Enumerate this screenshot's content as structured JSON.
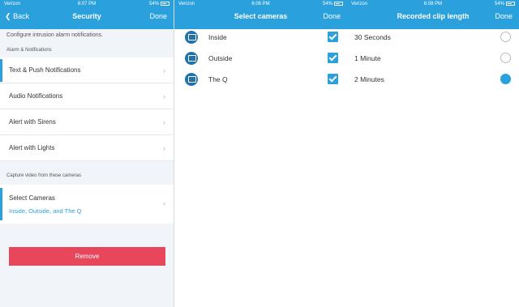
{
  "panel1": {
    "status": {
      "carrier": "Verizon",
      "time": "6:07 PM",
      "battery": "54%"
    },
    "nav": {
      "back_label": "Back",
      "title": "Security",
      "done_label": "Done"
    },
    "description": "Configure intrusion alarm notifications.",
    "alarm_section_label": "Alarm & Notifications",
    "menu_items": [
      {
        "label": "Text & Push Notifications"
      },
      {
        "label": "Audio Notifications"
      },
      {
        "label": "Alert with Sirens"
      },
      {
        "label": "Alert with Lights"
      }
    ],
    "capture_section_label": "Capture video from these cameras",
    "select_cameras": {
      "title": "Select Cameras",
      "value": "Inside, Outside, and The Q"
    },
    "remove_label": "Remove"
  },
  "panel2": {
    "status": {
      "carrier": "Verizon",
      "time": "6:06 PM",
      "battery": "54%"
    },
    "nav": {
      "title": "Select cameras",
      "done_label": "Done"
    },
    "cameras": [
      {
        "name": "Inside",
        "checked": true
      },
      {
        "name": "Outside",
        "checked": true
      },
      {
        "name": "The Q",
        "checked": true
      }
    ]
  },
  "panel3": {
    "status": {
      "carrier": "Verizon",
      "time": "6:08 PM",
      "battery": "54%"
    },
    "nav": {
      "title": "Recorded clip length",
      "done_label": "Done"
    },
    "options": [
      {
        "label": "30 Seconds",
        "selected": false
      },
      {
        "label": "1 Minute",
        "selected": false
      },
      {
        "label": "2 Minutes",
        "selected": true
      }
    ]
  },
  "colors": {
    "accent": "#2aa0dc",
    "danger": "#e8465a",
    "camera_icon": "#2272a7"
  }
}
